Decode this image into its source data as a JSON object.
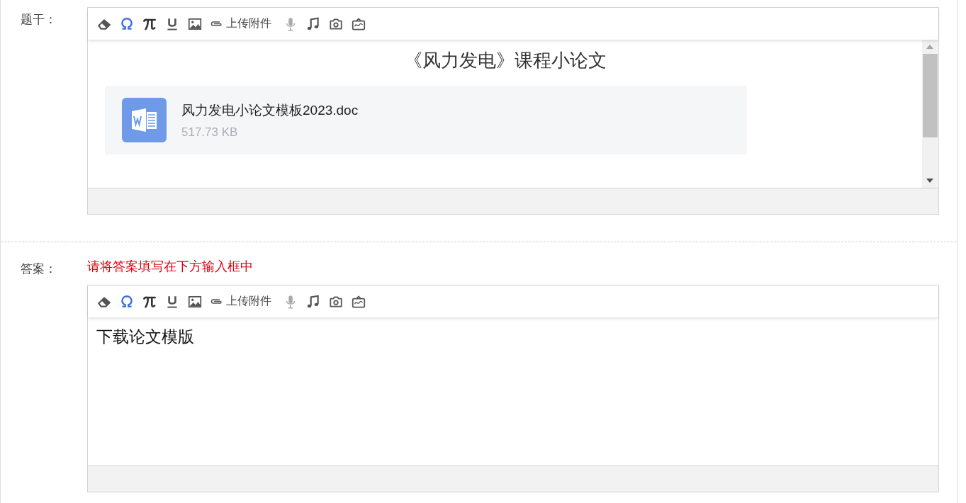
{
  "sections": [
    {
      "label": "题干：",
      "editor": {
        "toolbar": {
          "upload_label": "上传附件"
        },
        "scrollbar": true,
        "content": {
          "title": "《风力发电》课程小论文",
          "attachment": {
            "file_name": "风力发电小论文模板2023.doc",
            "size": "517.73 KB"
          }
        }
      }
    },
    {
      "label": "答案：",
      "hint": "请将答案填写在下方输入框中",
      "editor": {
        "toolbar": {
          "upload_label": "上传附件"
        },
        "scrollbar": false,
        "content": {
          "text": "下载论文模版"
        }
      }
    }
  ]
}
